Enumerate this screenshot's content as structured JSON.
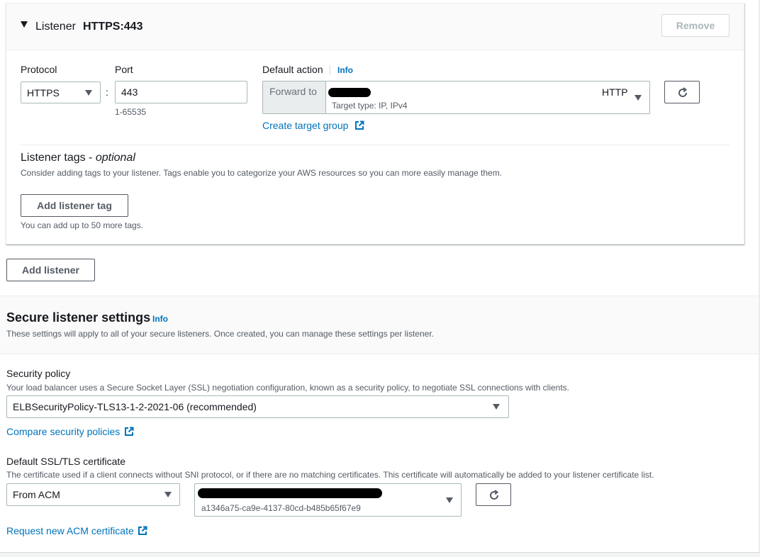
{
  "listener": {
    "header_label": "Listener",
    "header_port": "HTTPS:443",
    "remove_label": "Remove",
    "protocol": {
      "label": "Protocol",
      "value": "HTTPS"
    },
    "port": {
      "label": "Port",
      "value": "443",
      "hint": "1-65535"
    },
    "separator": ":",
    "default_action": {
      "label": "Default action",
      "info": "Info",
      "prefix": "Forward to",
      "target_protocol": "HTTP",
      "target_type": "Target type: IP, IPv4"
    },
    "create_target_group": "Create target group",
    "tags": {
      "title": "Listener tags - ",
      "title_optional": "optional",
      "description": "Consider adding tags to your listener. Tags enable you to categorize your AWS resources so you can more easily manage them.",
      "add_label": "Add listener tag",
      "limit_text": "You can add up to 50 more tags."
    }
  },
  "add_listener_label": "Add listener",
  "secure_settings": {
    "title": "Secure listener settings",
    "info": "Info",
    "description": "These settings will apply to all of your secure listeners. Once created, you can manage these settings per listener.",
    "security_policy": {
      "label": "Security policy",
      "description": "Your load balancer uses a Secure Socket Layer (SSL) negotiation configuration, known as a security policy, to negotiate SSL connections with clients.",
      "value": "ELBSecurityPolicy-TLS13-1-2-2021-06 (recommended)"
    },
    "compare_link": "Compare security policies",
    "certificate": {
      "label": "Default SSL/TLS certificate",
      "description": "The certificate used if a client connects without SNI protocol, or if there are no matching certificates. This certificate will automatically be added to your listener certificate list.",
      "source_value": "From ACM",
      "cert_id": "a1346a75-ca9e-4137-80cd-b485b65f67e9"
    },
    "request_link": "Request new ACM certificate"
  },
  "icons": {
    "caret": "caret-down-icon",
    "external": "external-link-icon",
    "refresh": "refresh-icon",
    "select": "chevron-down-icon"
  },
  "colors": {
    "link": "#0073bb",
    "text": "#16191f",
    "muted": "#545b64",
    "band": "#fafafa"
  }
}
